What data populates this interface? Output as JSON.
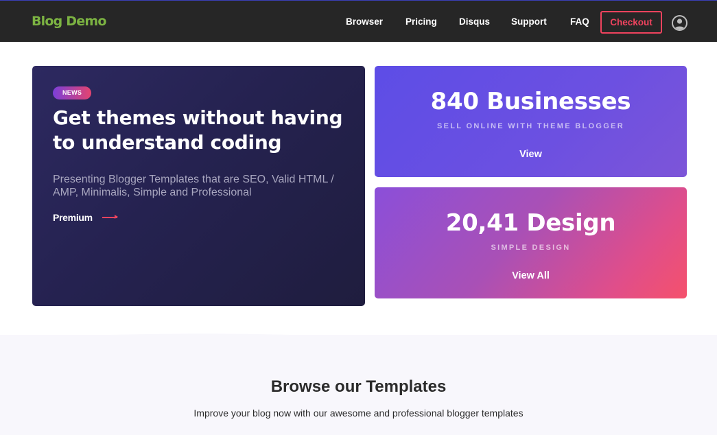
{
  "header": {
    "logo": "Blog Demo",
    "nav": [
      "Browser",
      "Pricing",
      "Disqus",
      "Support",
      "FAQ"
    ],
    "checkout": "Checkout",
    "avatar_icon": "user-icon"
  },
  "hero": {
    "badge": "NEWS",
    "title": "Get themes without having to understand coding",
    "description": "Presenting Blogger Templates that are SEO, Valid HTML / AMP, Minimalis, Simple and Professional",
    "link": "Premium",
    "link_icon": "arrow-right-icon"
  },
  "cards": [
    {
      "number": "840 Businesses",
      "subtitle": "SELL ONLINE WITH THEME BLOGGER",
      "link": "View"
    },
    {
      "number": "20,41 Design",
      "subtitle": "SIMPLE DESIGN",
      "link": "View All"
    }
  ],
  "section": {
    "title": "Browse our Templates",
    "subtitle": "Improve your blog now with our awesome and professional blogger templates"
  },
  "colors": {
    "nav_bg": "#262626",
    "logo": "#7cb342",
    "accent": "#f0435e",
    "hero_bg": "#252250",
    "card_a": "#6450e3",
    "card_b_start": "#8b4fd9",
    "card_b_end": "#f5516c",
    "section_bg": "#f8f7fc"
  }
}
